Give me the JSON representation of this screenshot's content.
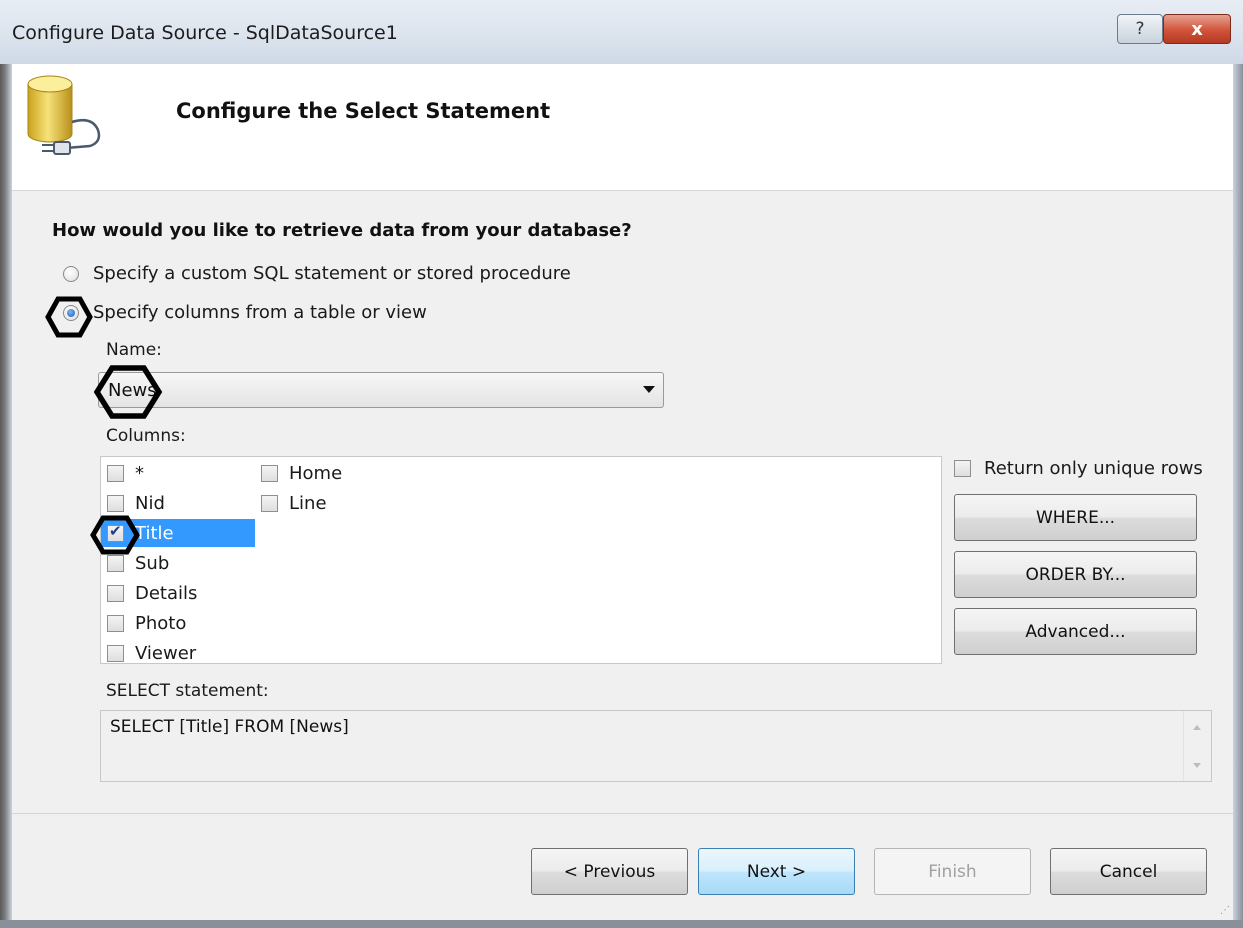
{
  "window": {
    "title": "Configure Data Source - SqlDataSource1",
    "help_label": "?",
    "close_label": "x"
  },
  "header": {
    "title": "Configure the Select Statement",
    "icon": "database-plug-icon"
  },
  "question": "How would you like to retrieve data from your database?",
  "options": [
    {
      "label": "Specify a custom SQL statement or stored procedure",
      "selected": false
    },
    {
      "label": "Specify columns from a table or view",
      "selected": true
    }
  ],
  "name": {
    "label": "Name:",
    "value": "News"
  },
  "columns": {
    "label": "Columns:",
    "items": [
      {
        "label": "*",
        "checked": false
      },
      {
        "label": "Nid",
        "checked": false
      },
      {
        "label": "Title",
        "checked": true
      },
      {
        "label": "Sub",
        "checked": false
      },
      {
        "label": "Details",
        "checked": false
      },
      {
        "label": "Photo",
        "checked": false
      },
      {
        "label": "Viewer",
        "checked": false
      },
      {
        "label": "Home",
        "checked": false
      },
      {
        "label": "Line",
        "checked": false
      }
    ]
  },
  "side": {
    "unique_label": "Return only unique rows",
    "where_label": "WHERE...",
    "order_label": "ORDER BY...",
    "advanced_label": "Advanced..."
  },
  "select_statement": {
    "label": "SELECT statement:",
    "text": "SELECT [Title] FROM [News]"
  },
  "footer": {
    "previous_label": "< Previous",
    "next_label": "Next >",
    "finish_label": "Finish",
    "cancel_label": "Cancel"
  },
  "colors": {
    "selection": "#3399ff",
    "annotation": "#000000"
  }
}
